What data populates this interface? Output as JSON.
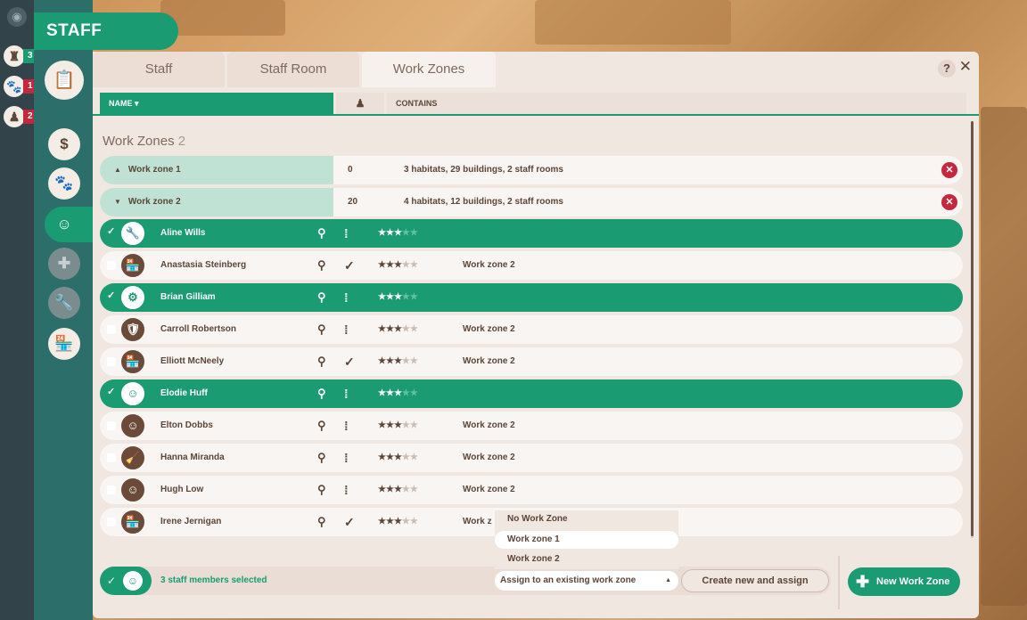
{
  "rail": {
    "alerts": [
      {
        "icon": "staff-icon",
        "count": "3",
        "color": "#1a9b72"
      },
      {
        "icon": "paw-icon",
        "count": "1",
        "color": "#c4283f"
      },
      {
        "icon": "keeper-icon",
        "count": "2",
        "color": "#c4283f"
      }
    ]
  },
  "header": {
    "title": "STAFF"
  },
  "tabs": [
    {
      "label": "Staff"
    },
    {
      "label": "Staff Room"
    },
    {
      "label": "Work Zones"
    }
  ],
  "help_label": "?",
  "close_label": "✕",
  "columns": {
    "name": "NAME ▾",
    "staff": "♟",
    "contains": "CONTAINS"
  },
  "section": {
    "title": "Work Zones",
    "count": "2"
  },
  "zones": [
    {
      "arrow": "▲",
      "name": "Work zone 1",
      "count": "0",
      "contains": "3 habitats, 29 buildings, 2 staff rooms"
    },
    {
      "arrow": "▼",
      "name": "Work zone 2",
      "count": "20",
      "contains": "4 habitats, 12 buildings, 2 staff rooms"
    }
  ],
  "staff": [
    {
      "name": "Aline Wills",
      "selected": true,
      "icon": "wrench-icon",
      "glyph": "🔧",
      "status": "walking",
      "stars": 3,
      "zone": ""
    },
    {
      "name": "Anastasia Steinberg",
      "selected": false,
      "icon": "vendor-icon",
      "glyph": "🏪",
      "status": "done",
      "stars": 3,
      "zone": "Work zone 2"
    },
    {
      "name": "Brian Gilliam",
      "selected": true,
      "icon": "mechanic-icon",
      "glyph": "⚙",
      "status": "walking",
      "stars": 3,
      "zone": ""
    },
    {
      "name": "Carroll Robertson",
      "selected": false,
      "icon": "security-icon",
      "glyph": "🛡",
      "status": "walking",
      "stars": 3,
      "zone": "Work zone 2"
    },
    {
      "name": "Elliott McNeely",
      "selected": false,
      "icon": "vendor-icon",
      "glyph": "🏪",
      "status": "done",
      "stars": 3,
      "zone": "Work zone 2"
    },
    {
      "name": "Elodie Huff",
      "selected": true,
      "icon": "keeper-icon",
      "glyph": "☺",
      "status": "walking",
      "stars": 3,
      "zone": ""
    },
    {
      "name": "Elton Dobbs",
      "selected": false,
      "icon": "keeper-icon",
      "glyph": "☺",
      "status": "walking",
      "stars": 3,
      "zone": "Work zone 2"
    },
    {
      "name": "Hanna Miranda",
      "selected": false,
      "icon": "janitor-icon",
      "glyph": "🧹",
      "status": "walking",
      "stars": 3,
      "zone": "Work zone 2"
    },
    {
      "name": "Hugh Low",
      "selected": false,
      "icon": "keeper-icon",
      "glyph": "☺",
      "status": "walking",
      "stars": 3,
      "zone": "Work zone 2"
    },
    {
      "name": "Irene Jernigan",
      "selected": false,
      "icon": "vendor-icon",
      "glyph": "🏪",
      "status": "done",
      "stars": 3,
      "zone": "Work z"
    }
  ],
  "footer": {
    "selected_text": "3 staff members selected",
    "assign_label": "Assign to an existing work zone",
    "create_label": "Create new and assign",
    "new_zone_label": "New Work Zone"
  },
  "dropdown": {
    "options": [
      "No Work Zone",
      "Work zone 1",
      "Work zone 2"
    ],
    "highlighted": "Work zone 1"
  },
  "colors": {
    "accent": "#1a9b72",
    "danger": "#c4283f",
    "brown": "#5b4638"
  }
}
